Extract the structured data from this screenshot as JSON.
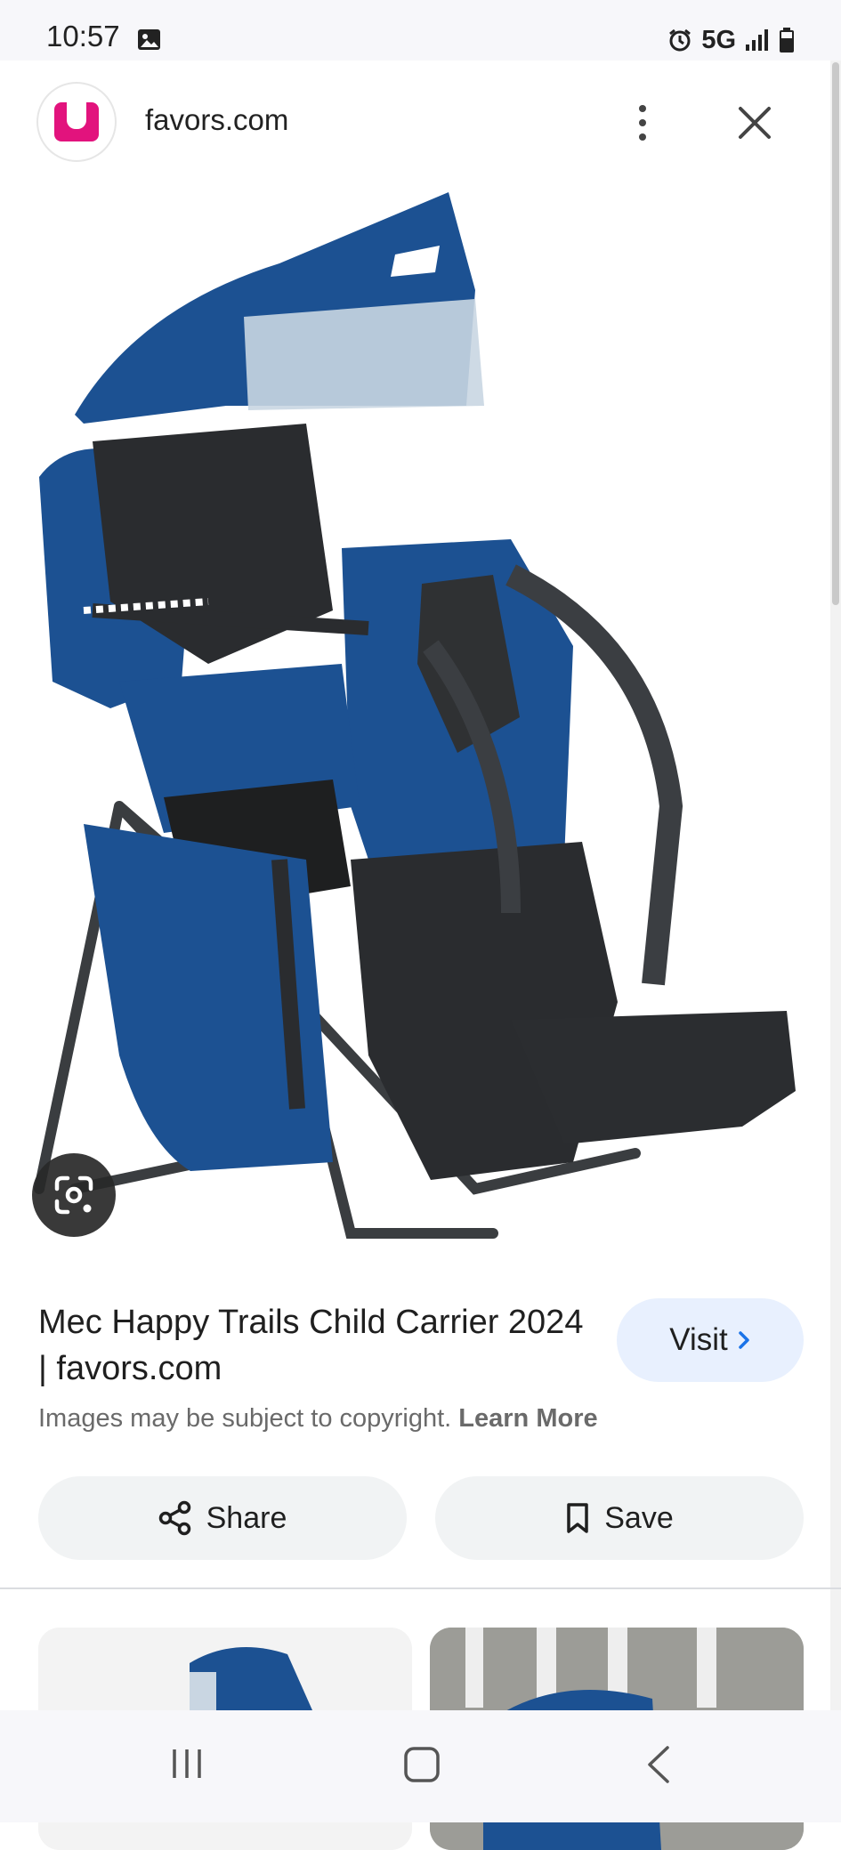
{
  "status_bar": {
    "time": "10:57",
    "network": "5G",
    "icons": [
      "photo-icon",
      "alarm-icon",
      "signal-icon",
      "battery-icon"
    ]
  },
  "top_bar": {
    "site_logo": "u",
    "domain": "favors.com",
    "menu_icon": "more-vert-icon",
    "close_icon": "close-icon"
  },
  "image": {
    "lens_icon": "google-lens-icon"
  },
  "result": {
    "title": "Mec Happy Trails Child Carrier 2024 | favors.com",
    "visit_label": "Visit",
    "copyright_text": "Images may be subject to copyright.",
    "learn_more": "Learn More"
  },
  "actions": {
    "share_label": "Share",
    "save_label": "Save"
  },
  "nav_bar": {
    "icons": [
      "recents-icon",
      "home-icon",
      "back-icon"
    ]
  },
  "colors": {
    "brand_magenta": "#e2137d",
    "carrier_blue": "#1c5192",
    "visit_bg": "#e8f0fe",
    "button_bg": "#f1f3f4"
  }
}
